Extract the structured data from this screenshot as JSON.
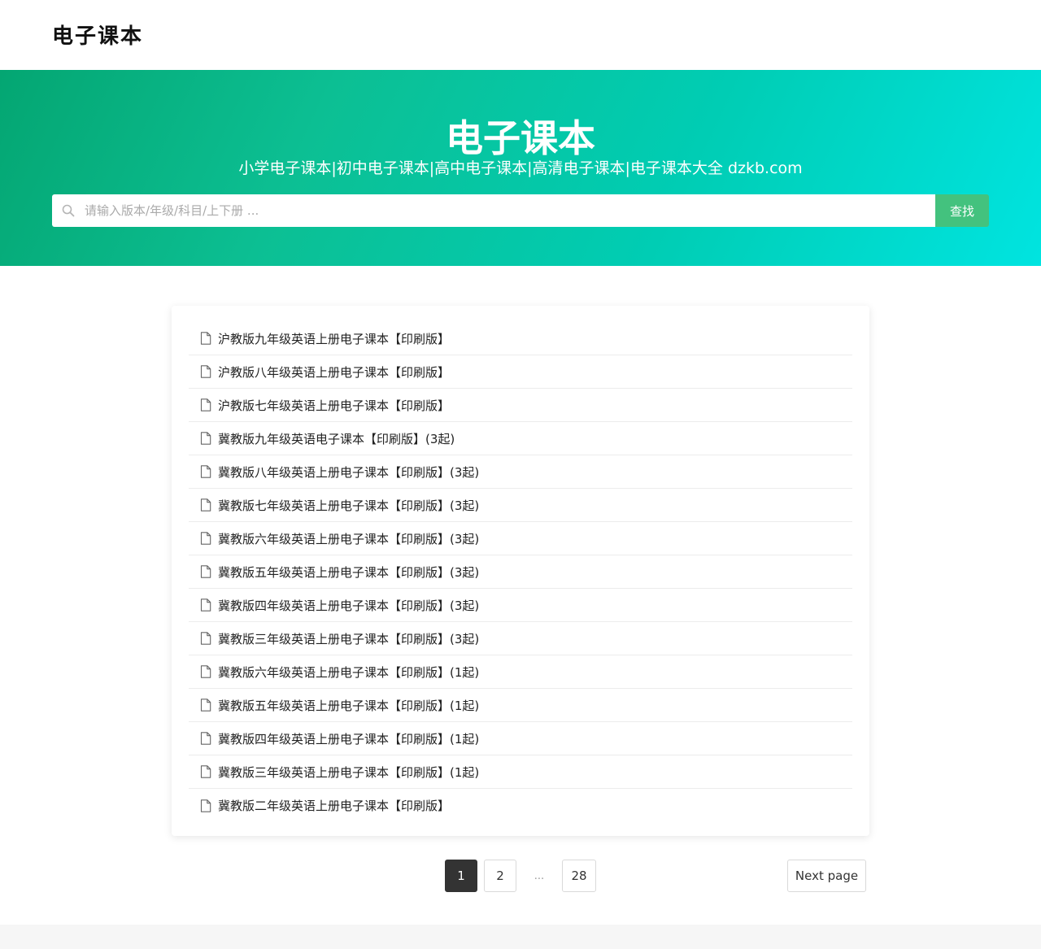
{
  "header": {
    "logo_text": "电子课本"
  },
  "hero": {
    "title": "电子课本",
    "subtitle": "小学电子课本|初中电子课本|高中电子课本|高清电子课本|电子课本大全 dzkb.com"
  },
  "search": {
    "placeholder": "请输入版本/年级/科目/上下册 ...",
    "value": "",
    "button_label": "查找",
    "icon": "search-icon"
  },
  "list": {
    "item_icon": "document-icon",
    "items": [
      "沪教版九年级英语上册电子课本【印刷版】",
      "沪教版八年级英语上册电子课本【印刷版】",
      "沪教版七年级英语上册电子课本【印刷版】",
      "冀教版九年级英语电子课本【印刷版】(3起)",
      "冀教版八年级英语上册电子课本【印刷版】(3起)",
      "冀教版七年级英语上册电子课本【印刷版】(3起)",
      "冀教版六年级英语上册电子课本【印刷版】(3起)",
      "冀教版五年级英语上册电子课本【印刷版】(3起)",
      "冀教版四年级英语上册电子课本【印刷版】(3起)",
      "冀教版三年级英语上册电子课本【印刷版】(3起)",
      "冀教版六年级英语上册电子课本【印刷版】(1起)",
      "冀教版五年级英语上册电子课本【印刷版】(1起)",
      "冀教版四年级英语上册电子课本【印刷版】(1起)",
      "冀教版三年级英语上册电子课本【印刷版】(1起)",
      "冀教版二年级英语上册电子课本【印刷版】"
    ]
  },
  "pagination": {
    "current": "1",
    "page2": "2",
    "ellipsis": "...",
    "last": "28",
    "next_label": "Next page"
  },
  "colors": {
    "hero_gradient_start": "#04a672",
    "hero_gradient_end": "#00e4e0",
    "search_button": "#43c27e",
    "active_page": "#333333"
  }
}
